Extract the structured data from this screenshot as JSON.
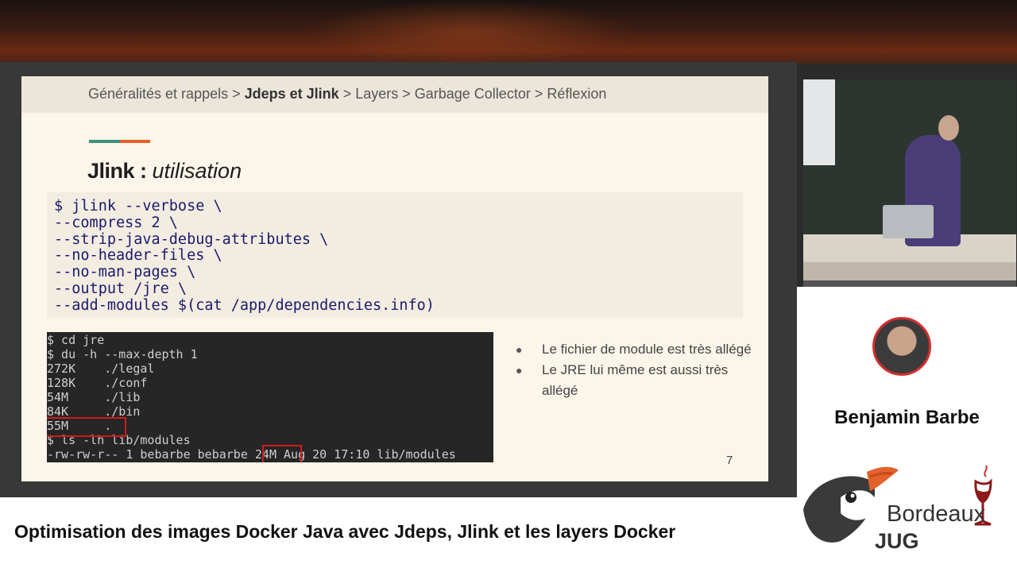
{
  "slide": {
    "breadcrumb": {
      "item1": "Généralités et rappels",
      "sep": " > ",
      "item2": "Jdeps et Jlink",
      "item3": "Layers",
      "item4": "Garbage Collector",
      "item5": "Réflexion"
    },
    "title_strong": "Jlink",
    "title_sep": " : ",
    "title_em": "utilisation",
    "code_lines": [
      "$ jlink --verbose \\",
      "--compress 2 \\",
      "--strip-java-debug-attributes \\",
      "--no-header-files \\",
      "--no-man-pages \\",
      "--output /jre \\",
      "--add-modules $(cat /app/dependencies.info)"
    ],
    "terminal_lines": [
      "$ cd jre",
      "$ du -h --max-depth 1",
      "272K    ./legal",
      "128K    ./conf",
      "54M     ./lib",
      "84K     ./bin",
      "55M     .",
      "$ ls -lh lib/modules",
      "-rw-rw-r-- 1 bebarbe bebarbe 24M Aug 20 17:10 lib/modules"
    ],
    "bullets": [
      "Le fichier de module est très allégé",
      "Le JRE lui même est aussi très allégé"
    ],
    "page_number": "7"
  },
  "speaker": {
    "name": "Benjamin Barbe"
  },
  "logo": {
    "text_top": "Bordeaux",
    "text_bottom": "JUG"
  },
  "talk": {
    "title": "Optimisation des images Docker Java avec Jdeps, Jlink et les layers Docker"
  },
  "colors": {
    "accent_green": "#3d8f7a",
    "accent_orange": "#e3622b",
    "highlight_red": "#d11a1a",
    "code_blue": "#1a1a6e"
  }
}
